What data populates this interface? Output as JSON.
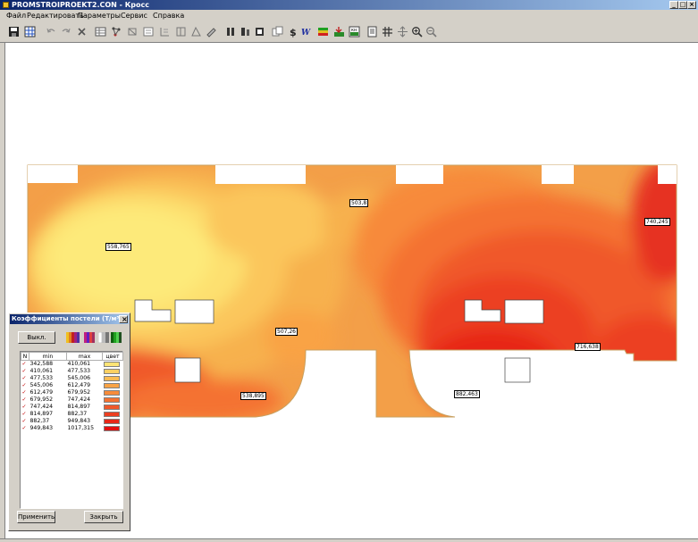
{
  "window": {
    "title": "PROMSTROIPROEKT2.CON - Кросс",
    "controls": [
      "_",
      "□",
      "×"
    ]
  },
  "menu": [
    "Файл",
    "Редактировать",
    "Параметры",
    "Сервис",
    "Справка"
  ],
  "toolbar": {
    "icons": [
      "save-icon",
      "grid-icon",
      "undo-icon",
      "redo-icon",
      "delete-icon",
      "table-icon",
      "nodes-icon",
      "elements-icon",
      "link-icon",
      "split-icon",
      "merge-icon",
      "mesh-icon",
      "paint-icon",
      "column-icon",
      "wall-icon",
      "slab-icon",
      "copy-icon",
      "dollar-icon",
      "w-icon",
      "color-map-icon",
      "ground-icon",
      "label-icon",
      "report-icon",
      "hatch-icon",
      "move-icon",
      "zoom-in-icon",
      "zoom-out-icon"
    ]
  },
  "map_labels": [
    {
      "text": "503,8"
    },
    {
      "text": "740,245"
    },
    {
      "text": "558,765"
    },
    {
      "text": "507,26"
    },
    {
      "text": "716,638"
    },
    {
      "text": "538,895"
    },
    {
      "text": "882,463"
    }
  ],
  "dialog": {
    "title": "Коэффициенты постели (Т/м³...",
    "close": "×",
    "off_button": "Выкл.",
    "columns": {
      "n": "N",
      "min": "min",
      "max": "max",
      "color": "цвет"
    },
    "rows": [
      {
        "min": "342,588",
        "max": "410,061",
        "color": "#fde475"
      },
      {
        "min": "410,061",
        "max": "477,533",
        "color": "#fcd062"
      },
      {
        "min": "477,533",
        "max": "545,006",
        "color": "#fbbb52"
      },
      {
        "min": "545,006",
        "max": "612,479",
        "color": "#f9a345"
      },
      {
        "min": "612,479",
        "max": "679,952",
        "color": "#f78c3b"
      },
      {
        "min": "679,952",
        "max": "747,424",
        "color": "#f47232"
      },
      {
        "min": "747,424",
        "max": "814,897",
        "color": "#f0582a"
      },
      {
        "min": "814,897",
        "max": "882,37",
        "color": "#ec3f21"
      },
      {
        "min": "882,37",
        "max": "949,843",
        "color": "#e72818"
      },
      {
        "min": "949,843",
        "max": "1017,315",
        "color": "#e31010"
      }
    ],
    "apply_button": "Применить",
    "close_button": "Закрыть"
  }
}
